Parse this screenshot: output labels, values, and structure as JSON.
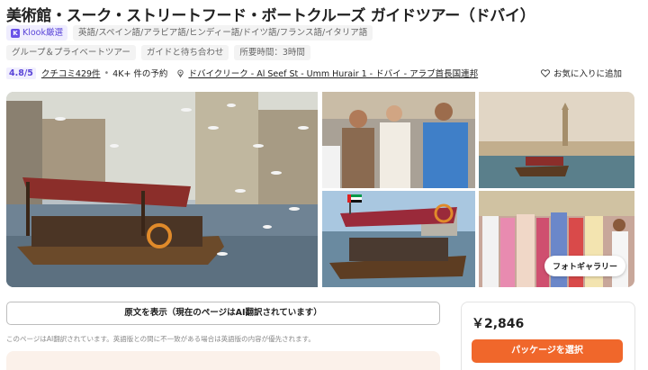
{
  "title": "美術館・スーク・ストリートフード・ボートクルーズ ガイドツアー（ドバイ）",
  "badge": {
    "label": "Klook厳選",
    "icon": "klook-badge-icon"
  },
  "languages": "英語/スペイン語/アラビア語/ヒンディー語/ドイツ語/フランス語/イタリア語",
  "tags": [
    "グループ＆プライベートツアー",
    "ガイドと待ち合わせ",
    "所要時間：3時間"
  ],
  "meta": {
    "rating": "4.8/5",
    "reviews": "クチコミ429件",
    "bookings": "4K+ 件の予約",
    "location": "ドバイクリーク - Al Seef St - Umm Hurair 1 - ドバイ - アラブ首長国連邦",
    "wishlist": "お気に入りに追加"
  },
  "gallery": {
    "photo_button": "フォトギャラリー",
    "images": [
      "abra-boat-gulls",
      "tasting-street-food",
      "creek-minaret",
      "abra-boat-flag",
      "souk-clothing"
    ]
  },
  "original_button": "原文を表示（現在のページはAI翻訳されています）",
  "notice": "このページはAI翻訳されています。英語版との間に不一致がある場合は英語版の内容が優先されます。",
  "price": "￥2,846",
  "select_package": "パッケージを選択",
  "colors": {
    "accent": "#f0672b",
    "brand": "#5a45d8"
  }
}
